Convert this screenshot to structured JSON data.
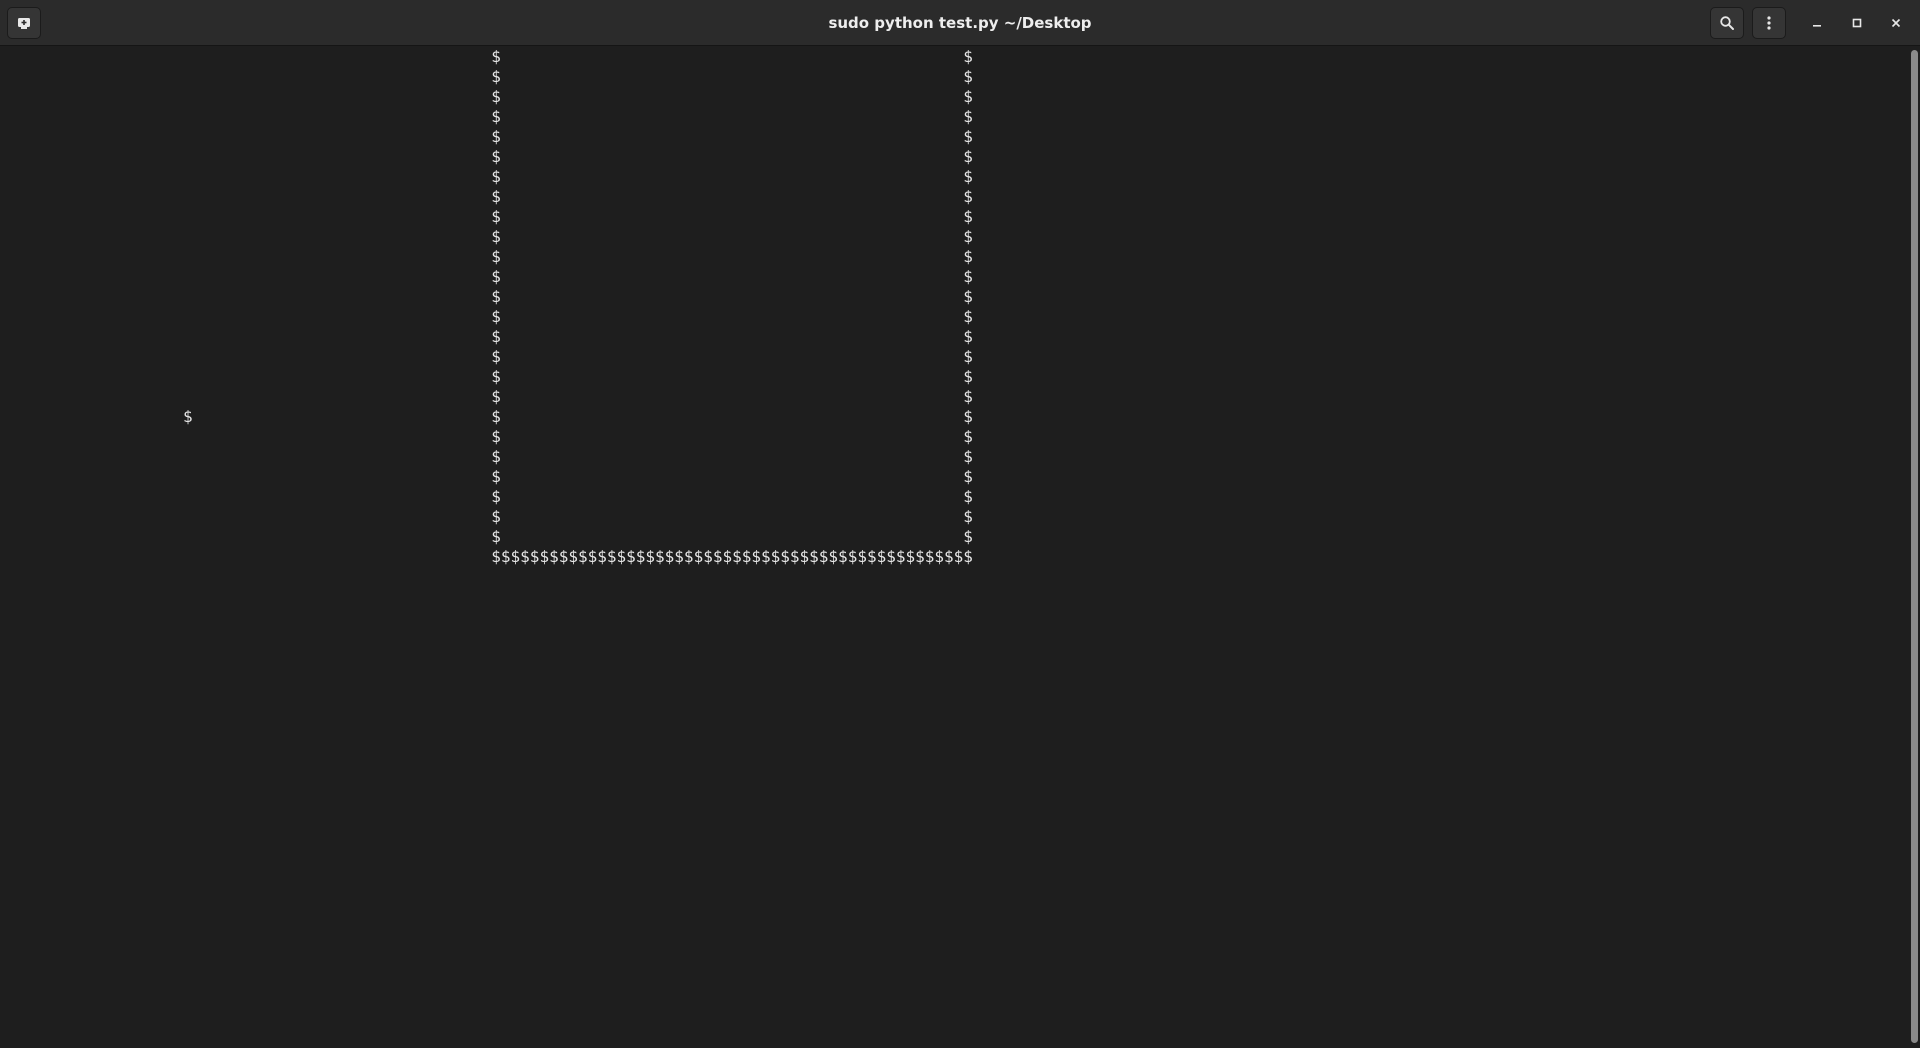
{
  "window": {
    "title": "sudo python test.py ~/Desktop"
  },
  "headerbar": {
    "new_tab_icon": "new-tab-icon",
    "search_icon": "search-icon",
    "menu_icon": "kebab-menu-icon",
    "minimize_icon": "minimize-icon",
    "maximize_icon": "maximize-icon",
    "close_icon": "close-icon"
  },
  "terminal": {
    "background": "#1e1e1e",
    "foreground": "#e6e6e6",
    "lines": [
      "                                                   $                                                $",
      "                                                   $                                                $",
      "                                                   $                                                $",
      "                                                   $                                                $",
      "                                                   $                                                $",
      "                                                   $                                                $",
      "                                                   $                                                $",
      "                                                   $                                                $",
      "                                                   $                                                $",
      "                                                   $                                                $",
      "                                                   $                                                $",
      "                                                   $                                                $",
      "                                                   $                                                $",
      "                                                   $                                                $",
      "                                                   $                                                $",
      "                                                   $                                                $",
      "                                                   $                                                $",
      "                                                   $                                                $",
      "                   $                               $                                                $",
      "                                                   $                                                $",
      "                                                   $                                                $",
      "                                                   $                                                $",
      "                                                   $                                                $",
      "                                                   $                                                $",
      "                                                   $                                                $",
      "                                                   $$$$$$$$$$$$$$$$$$$$$$$$$$$$$$$$$$$$$$$$$$$$$$$$$$"
    ]
  }
}
